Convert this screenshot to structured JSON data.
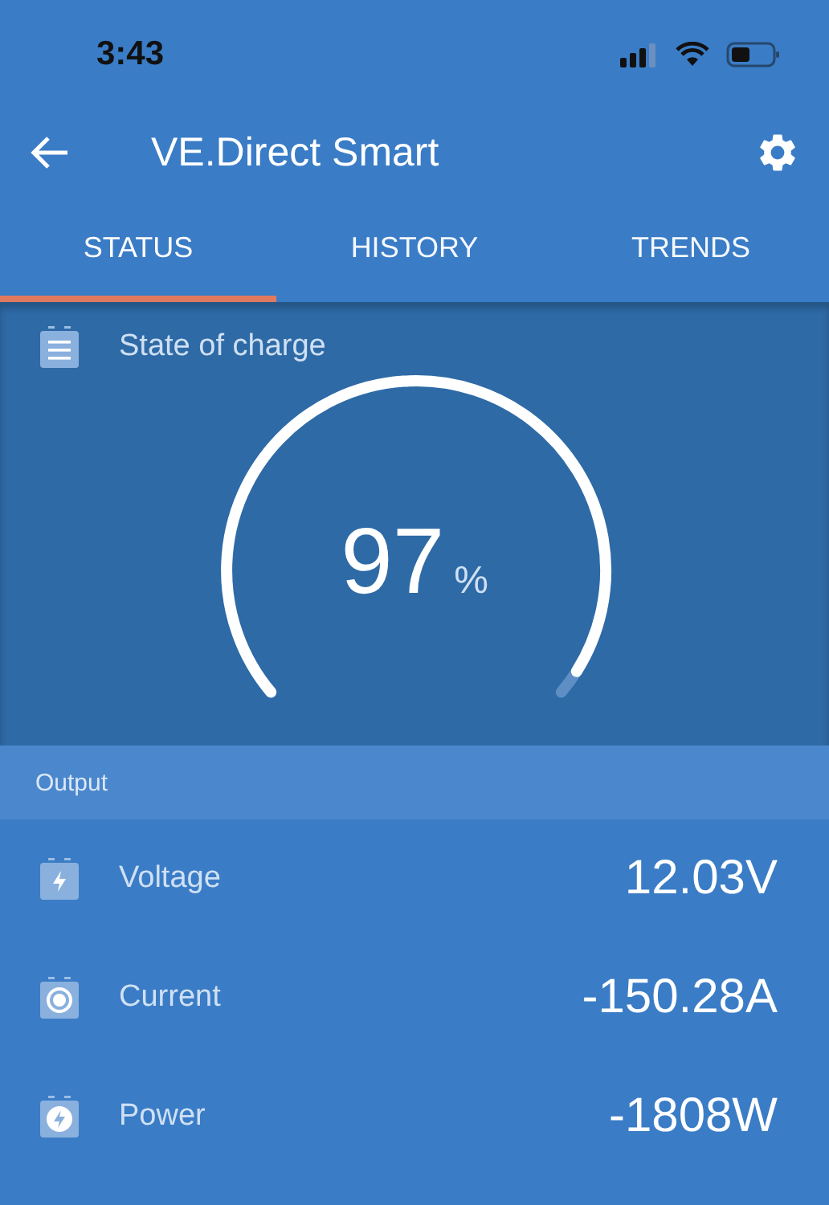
{
  "status_bar": {
    "time": "3:43"
  },
  "app_bar": {
    "title": "VE.Direct Smart"
  },
  "tabs": [
    {
      "label": "STATUS",
      "selected": true
    },
    {
      "label": "HISTORY",
      "selected": false
    },
    {
      "label": "TRENDS",
      "selected": false
    }
  ],
  "state_of_charge": {
    "label": "State of charge",
    "value": "97",
    "unit": "%"
  },
  "output": {
    "header": "Output",
    "rows": [
      {
        "kind": "voltage",
        "label": "Voltage",
        "value": "12.03V"
      },
      {
        "kind": "current",
        "label": "Current",
        "value": "-150.28A"
      },
      {
        "kind": "power",
        "label": "Power",
        "value": "-1808W"
      }
    ]
  }
}
